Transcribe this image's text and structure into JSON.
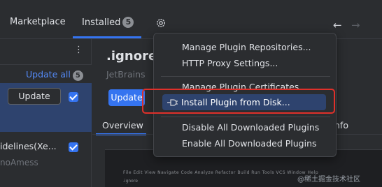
{
  "tabs": {
    "marketplace": "Marketplace",
    "installed": "Installed",
    "installed_count": "5"
  },
  "left_panel": {
    "update_all": "Update all",
    "update_all_count": "5",
    "update_button": "Update",
    "plugin2_name": "idelines(Xe...",
    "plugin2_vendor": "noAmess"
  },
  "detail": {
    "title": ".ignore",
    "vendor": "JetBrains",
    "update_button": "Update",
    "tab_overview": "Overview",
    "tab_info": "nfo"
  },
  "preview": {
    "menubar": "File  Edit  View  Navigate  Code  Analyze  Refactor  Build  Run  Tools  VCS  Window  Help",
    "path": ".ignore",
    "watermark": "@稀土掘金技术社区"
  },
  "menu": {
    "items": [
      "Manage Plugin Repositories...",
      "HTTP Proxy Settings...",
      "Manage Plugin Certificates",
      "Install Plugin from Disk...",
      "Disable All Downloaded Plugins",
      "Enable All Downloaded Plugins"
    ]
  },
  "colors": {
    "accent": "#3574f0",
    "selection": "#2e436e",
    "highlight_box": "#e0302a",
    "background": "#2b2d30"
  },
  "icons": [
    "gear-icon",
    "back-arrow-icon",
    "forward-arrow-icon",
    "kebab-menu-icon",
    "plug-icon",
    "checkbox-icon"
  ]
}
